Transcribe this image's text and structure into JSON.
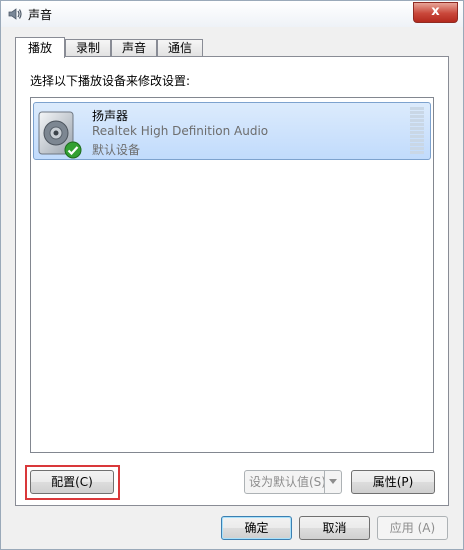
{
  "window": {
    "title": "声音",
    "close_label": "x"
  },
  "tabs": [
    {
      "label": "播放",
      "active": true
    },
    {
      "label": "录制",
      "active": false
    },
    {
      "label": "声音",
      "active": false
    },
    {
      "label": "通信",
      "active": false
    }
  ],
  "playback": {
    "instruction": "选择以下播放设备来修改设置:",
    "devices": [
      {
        "name": "扬声器",
        "description": "Realtek High Definition Audio",
        "status": "默认设备",
        "icon": "speaker-icon",
        "status_icon": "check-icon"
      }
    ]
  },
  "buttons": {
    "configure": "配置(C)",
    "set_default": "设为默认值(S)",
    "properties": "属性(P)",
    "ok": "确定",
    "cancel": "取消",
    "apply": "应用 (A)"
  },
  "colors": {
    "selection": "#cce3fc",
    "highlight_border": "#d9383a"
  }
}
